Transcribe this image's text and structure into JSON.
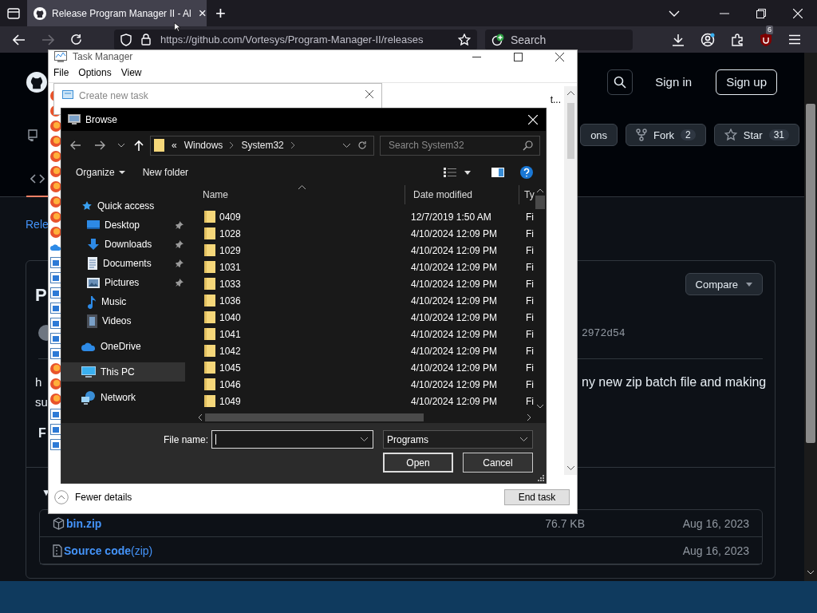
{
  "browser": {
    "tab": {
      "title": "Release Program Manager II - Al",
      "close": "×"
    },
    "new_tab": "+",
    "address": "https://github.com/Vortesys/Program-Manager-II/releases",
    "search": {
      "placeholder": "Search"
    },
    "extension_badge": "6"
  },
  "github": {
    "header": {
      "sign_in": "Sign in",
      "sign_up": "Sign up"
    },
    "repo_actions": [
      {
        "label": "ons"
      },
      {
        "label": "Fork",
        "count": "2"
      },
      {
        "label": "Star",
        "count": "31"
      }
    ],
    "breadcrumb_fragment": "Rele",
    "release": {
      "title_fragment": "P",
      "compare": "Compare",
      "commit": "2972d54",
      "body_lines": [
        {
          "left": "h",
          "right": "ny new zip batch file and making"
        },
        {
          "left": "su"
        }
      ],
      "footer_fragment": "F",
      "assets_toggle": "▼",
      "assets": [
        {
          "name": "bin.zip",
          "size": "76.7 KB",
          "date": "Aug 16, 2023"
        },
        {
          "name": "Source code",
          "suffix": "(zip)",
          "date": "Aug 16, 2023"
        }
      ]
    }
  },
  "task_manager": {
    "title": "Task Manager",
    "menu": [
      "File",
      "Options",
      "View"
    ],
    "column_fragment": "t...",
    "fewer_details": "Fewer details",
    "end_task": "End task",
    "process_icons": [
      {
        "kind": "firefox"
      },
      {
        "kind": "firefox"
      },
      {
        "kind": "firefox"
      },
      {
        "kind": "firefox"
      },
      {
        "kind": "firefox"
      },
      {
        "kind": "firefox"
      },
      {
        "kind": "firefox"
      },
      {
        "kind": "firefox"
      },
      {
        "kind": "firefox"
      },
      {
        "kind": "firefox"
      },
      {
        "kind": "cloud"
      },
      {
        "kind": "app"
      },
      {
        "kind": "app"
      },
      {
        "kind": "app"
      },
      {
        "kind": "app"
      },
      {
        "kind": "app"
      },
      {
        "kind": "app"
      },
      {
        "kind": "app"
      },
      {
        "kind": "firefox"
      },
      {
        "kind": "firefox"
      },
      {
        "kind": "firefox"
      },
      {
        "kind": "app"
      },
      {
        "kind": "app"
      },
      {
        "kind": "app"
      }
    ]
  },
  "create_task": {
    "title": "Create new task"
  },
  "browse": {
    "title": "Browse",
    "path_overflow": "«",
    "path": [
      "Windows",
      "System32"
    ],
    "search": {
      "placeholder": "Search System32"
    },
    "toolbar": {
      "organize": "Organize",
      "new_folder": "New folder"
    },
    "nav": [
      {
        "label": "Quick access",
        "kind": "star",
        "selected": false,
        "children": [
          {
            "label": "Desktop",
            "kind": "desktop",
            "pinned": true,
            "selected": false
          },
          {
            "label": "Downloads",
            "kind": "download",
            "pinned": true,
            "selected": false
          },
          {
            "label": "Documents",
            "kind": "document",
            "pinned": true,
            "selected": false
          },
          {
            "label": "Pictures",
            "kind": "picture",
            "pinned": true,
            "selected": false
          },
          {
            "label": "Music",
            "kind": "music",
            "pinned": false,
            "selected": false
          },
          {
            "label": "Videos",
            "kind": "video",
            "pinned": false,
            "selected": false
          }
        ]
      },
      {
        "label": "OneDrive",
        "kind": "cloud",
        "selected": false
      },
      {
        "label": "This PC",
        "kind": "computer",
        "selected": true
      },
      {
        "label": "Network",
        "kind": "network",
        "selected": false
      }
    ],
    "columns": [
      "Name",
      "Date modified",
      "Ty"
    ],
    "files": [
      {
        "name": "0409",
        "date": "12/7/2019 1:50 AM",
        "type": "Fi"
      },
      {
        "name": "1028",
        "date": "4/10/2024 12:09 PM",
        "type": "Fi"
      },
      {
        "name": "1029",
        "date": "4/10/2024 12:09 PM",
        "type": "Fi"
      },
      {
        "name": "1031",
        "date": "4/10/2024 12:09 PM",
        "type": "Fi"
      },
      {
        "name": "1033",
        "date": "4/10/2024 12:09 PM",
        "type": "Fi"
      },
      {
        "name": "1036",
        "date": "4/10/2024 12:09 PM",
        "type": "Fi"
      },
      {
        "name": "1040",
        "date": "4/10/2024 12:09 PM",
        "type": "Fi"
      },
      {
        "name": "1041",
        "date": "4/10/2024 12:09 PM",
        "type": "Fi"
      },
      {
        "name": "1042",
        "date": "4/10/2024 12:09 PM",
        "type": "Fi"
      },
      {
        "name": "1045",
        "date": "4/10/2024 12:09 PM",
        "type": "Fi"
      },
      {
        "name": "1046",
        "date": "4/10/2024 12:09 PM",
        "type": "Fi"
      },
      {
        "name": "1049",
        "date": "4/10/2024 12:09 PM",
        "type": "Fi"
      }
    ],
    "file_name_label": "File name:",
    "file_type": "Programs",
    "buttons": {
      "open": "Open",
      "cancel": "Cancel"
    }
  }
}
